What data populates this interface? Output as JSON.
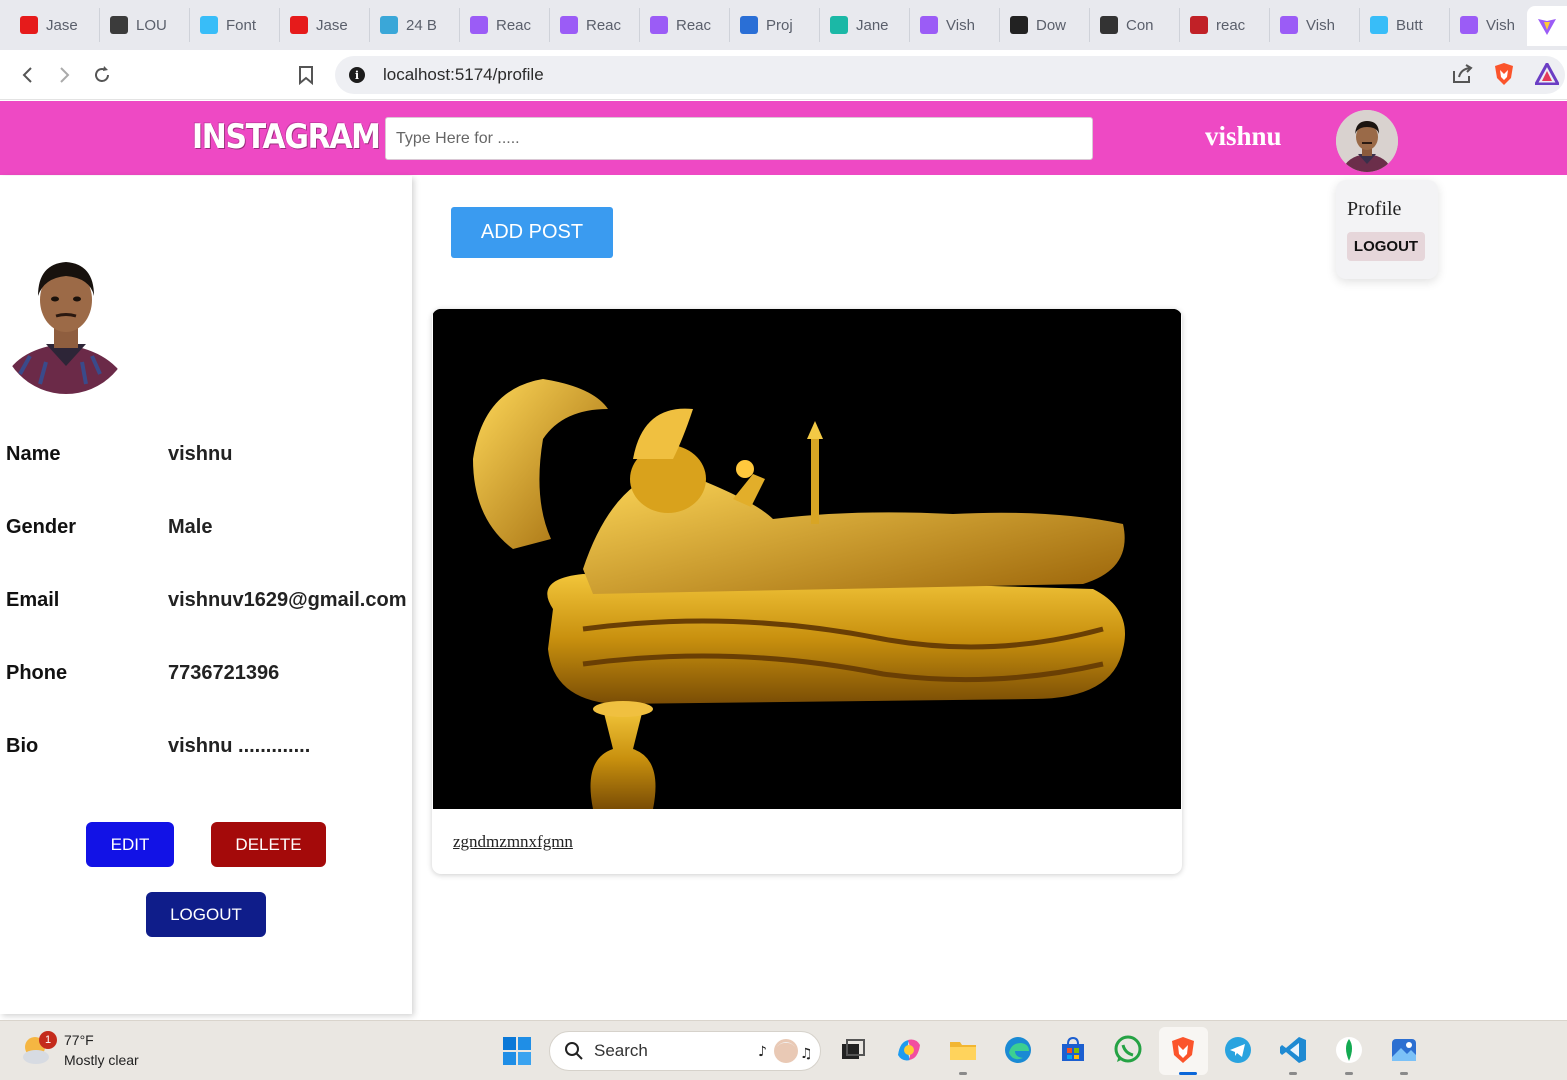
{
  "browser": {
    "tabs": [
      {
        "label": "Jase",
        "icon": "j-icon",
        "color": "#e61b1b"
      },
      {
        "label": "LOU",
        "icon": "ls-icon",
        "color": "#3b3b3b"
      },
      {
        "label": "Font",
        "icon": "tailwind-icon",
        "color": "#38bdf8"
      },
      {
        "label": "Jase",
        "icon": "j-icon",
        "color": "#e61b1b"
      },
      {
        "label": "24 B",
        "icon": "react-icon",
        "color": "#3aa7d8"
      },
      {
        "label": "Reac",
        "icon": "vite-icon",
        "color": "#9b5cf6"
      },
      {
        "label": "Reac",
        "icon": "vite-icon",
        "color": "#9b5cf6"
      },
      {
        "label": "Reac",
        "icon": "vite-icon",
        "color": "#9b5cf6"
      },
      {
        "label": "Proj",
        "icon": "project-icon",
        "color": "#2a6fd6"
      },
      {
        "label": "Jane",
        "icon": "jane-icon",
        "color": "#1bb8a6"
      },
      {
        "label": "Vish",
        "icon": "vite-icon",
        "color": "#9b5cf6"
      },
      {
        "label": "Dow",
        "icon": "png-icon",
        "color": "#222222"
      },
      {
        "label": "Con",
        "icon": "openai-icon",
        "color": "#333333"
      },
      {
        "label": "reac",
        "icon": "npm-icon",
        "color": "#c12127"
      },
      {
        "label": "Vish",
        "icon": "vite-icon",
        "color": "#9b5cf6"
      },
      {
        "label": "Butt",
        "icon": "tailwind-icon",
        "color": "#38bdf8"
      },
      {
        "label": "Vish",
        "icon": "vite-icon",
        "color": "#9b5cf6"
      }
    ],
    "url": "localhost:5174/profile"
  },
  "header": {
    "logo": "INSTAGRAM",
    "search_placeholder": "Type Here for .....",
    "username": "vishnu",
    "colors": {
      "bar": "#ee49c4"
    }
  },
  "dropdown": {
    "profile_label": "Profile",
    "logout_label": "LOGOUT"
  },
  "profile": {
    "fields": [
      {
        "label": "Name",
        "value": "vishnu"
      },
      {
        "label": "Gender",
        "value": "Male"
      },
      {
        "label": "Email",
        "value": "vishnuv1629@gmail.com"
      },
      {
        "label": "Phone",
        "value": "7736721396"
      },
      {
        "label": "Bio",
        "value": "vishnu ............."
      }
    ],
    "edit_label": "EDIT",
    "delete_label": "DELETE",
    "logout_label": "LOGOUT",
    "colors": {
      "edit": "#1212e6",
      "delete": "#a40a0a",
      "logout": "#0f1d8a"
    }
  },
  "main": {
    "add_post_label": "ADD POST",
    "posts": [
      {
        "caption": "zgndmzmnxfgmn"
      }
    ]
  },
  "taskbar": {
    "weather_temp": "77°F",
    "weather_desc": "Mostly clear",
    "weather_badge": "1",
    "search_label": "Search"
  }
}
